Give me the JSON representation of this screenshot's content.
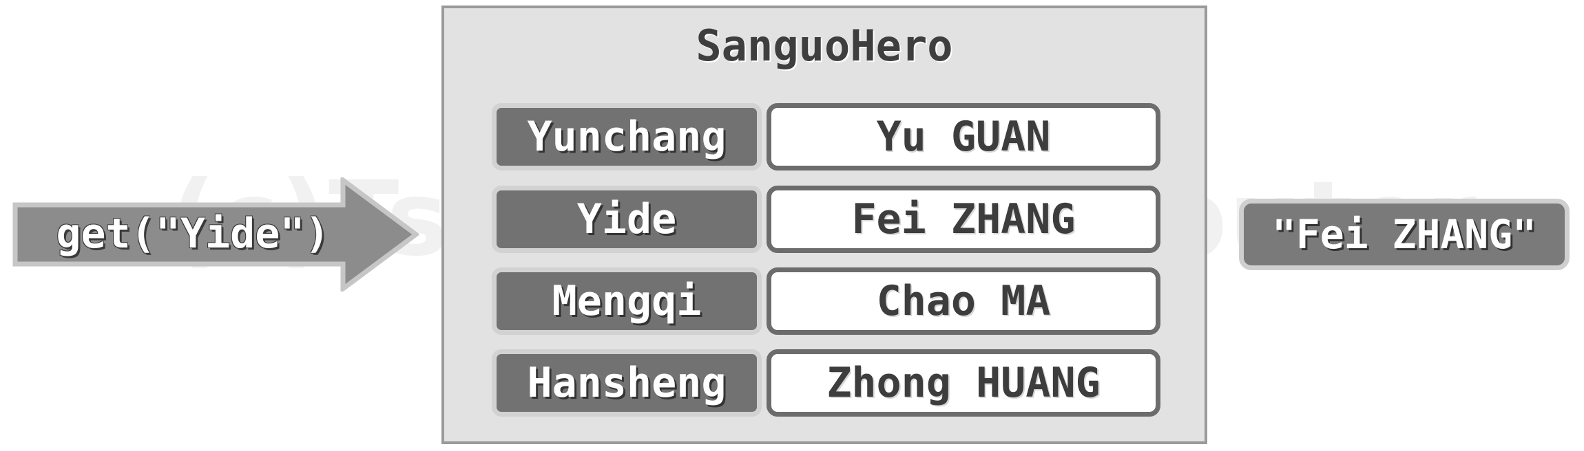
{
  "watermark": "(c)Tsinghua Computer",
  "call": {
    "label": "get(\"Yide\")"
  },
  "map": {
    "title": "SanguoHero",
    "entries": [
      {
        "key": "Yunchang",
        "value": "Yu GUAN"
      },
      {
        "key": "Yide",
        "value": "Fei ZHANG"
      },
      {
        "key": "Mengqi",
        "value": "Chao MA"
      },
      {
        "key": "Hansheng",
        "value": "Zhong HUANG"
      }
    ]
  },
  "result": {
    "label": "\"Fei ZHANG\""
  },
  "colors": {
    "container_bg": "#e2e2e2",
    "key_bg": "#727272",
    "value_bg": "#ffffff",
    "arrow_fill": "#8c8c8c"
  }
}
